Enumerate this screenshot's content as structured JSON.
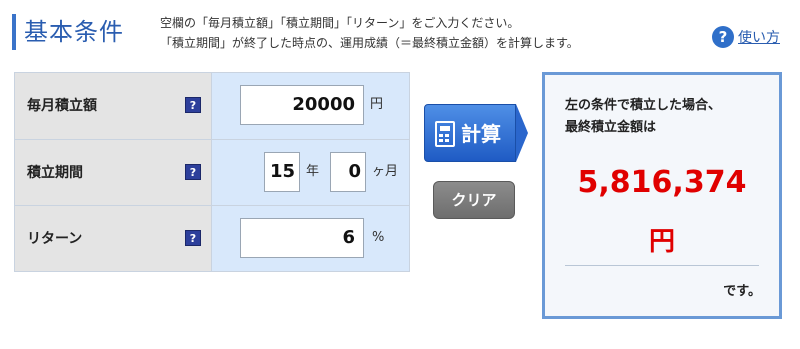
{
  "header": {
    "title": "基本条件",
    "desc_line1": "空欄の「毎月積立額」「積立期間」「リターン」をご入力ください。",
    "desc_line2": "「積立期間」が終了した時点の、運用成績（＝最終積立金額）を計算します。",
    "help_icon_glyph": "?",
    "help_label": "使い方"
  },
  "form": {
    "monthly": {
      "label": "毎月積立額",
      "value": "20000",
      "unit": "円",
      "help_glyph": "?"
    },
    "period": {
      "label": "積立期間",
      "years": "15",
      "years_unit": "年",
      "months": "0",
      "months_unit": "ヶ月",
      "help_glyph": "?"
    },
    "return": {
      "label": "リターン",
      "value": "6",
      "unit": "%",
      "help_glyph": "?"
    }
  },
  "buttons": {
    "calc_label": "計算",
    "clear_label": "クリア"
  },
  "result": {
    "lead_line1": "左の条件で積立した場合、",
    "lead_line2": "最終積立金額は",
    "amount": "5,816,374",
    "yen": "円",
    "suffix": "です。"
  },
  "colors": {
    "accent": "#2a5db0",
    "result_red": "#e00000",
    "value_bg": "#d8e8fb",
    "label_bg": "#e4e4e4"
  }
}
